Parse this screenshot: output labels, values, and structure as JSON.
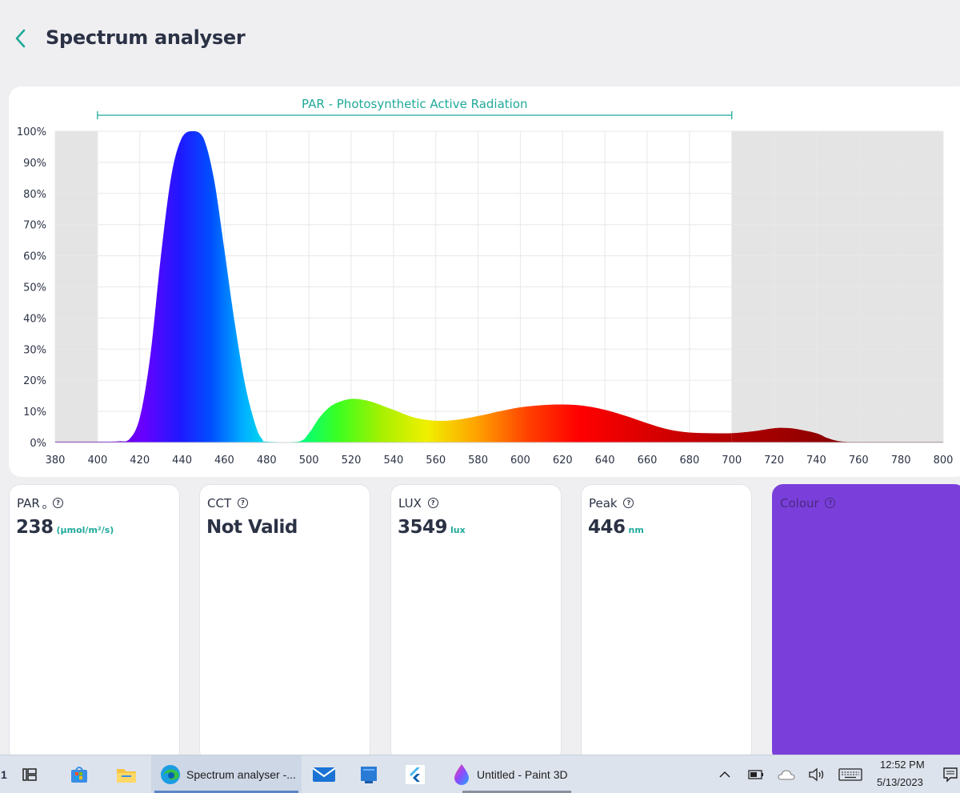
{
  "header": {
    "title": "Spectrum analyser"
  },
  "chart_data": {
    "type": "area",
    "title": "PAR - Photosynthetic Active Radiation",
    "xlabel": "",
    "ylabel": "",
    "xlim": [
      380,
      800
    ],
    "ylim": [
      0,
      100
    ],
    "x_ticks": [
      "380",
      "400",
      "420",
      "440",
      "460",
      "480",
      "500",
      "520",
      "540",
      "560",
      "580",
      "600",
      "620",
      "640",
      "660",
      "680",
      "700",
      "720",
      "740",
      "760",
      "780",
      "800"
    ],
    "y_ticks": [
      "0%",
      "10%",
      "20%",
      "30%",
      "40%",
      "50%",
      "60%",
      "70%",
      "80%",
      "90%",
      "100%"
    ],
    "par_range": [
      400,
      700
    ],
    "grid": true,
    "series": [
      {
        "x": [
          380,
          400,
          410,
          415,
          420,
          425,
          430,
          435,
          440,
          445,
          450,
          455,
          460,
          465,
          470,
          475,
          478,
          480,
          495,
          500,
          505,
          510,
          515,
          520,
          525,
          530,
          540,
          550,
          560,
          570,
          580,
          590,
          600,
          610,
          620,
          630,
          640,
          650,
          660,
          670,
          680,
          690,
          700,
          710,
          720,
          725,
          730,
          740,
          745,
          750,
          755,
          760,
          780,
          800
        ],
        "y": [
          0.3,
          0.3,
          0.4,
          1,
          8,
          28,
          60,
          86,
          98,
          100,
          98,
          85,
          62,
          38,
          18,
          5,
          1,
          0.3,
          0.3,
          3,
          8,
          11.5,
          13.2,
          14,
          13.8,
          13,
          10.5,
          8,
          7,
          7.3,
          8.5,
          10,
          11.3,
          12,
          12.2,
          11.8,
          10.5,
          8.5,
          6.2,
          4.2,
          3.2,
          3,
          3,
          3.6,
          4.6,
          4.7,
          4.4,
          3,
          1.5,
          0.5,
          0.2,
          0.2,
          0.2,
          0.2
        ]
      }
    ]
  },
  "cards": {
    "par": {
      "label": "PAR",
      "sub": "o",
      "value": "238",
      "unit": "(μmol/m²/s)"
    },
    "cct": {
      "label": "CCT",
      "value": "Not Valid"
    },
    "lux": {
      "label": "LUX",
      "value": "3549",
      "unit": "lux"
    },
    "peak": {
      "label": "Peak",
      "value": "446",
      "unit": "nm"
    },
    "colour": {
      "label": "Colour",
      "color": "#7a3fdb"
    }
  },
  "help_icon_glyph": "?",
  "taskbar": {
    "edge_label": "Spectrum analyser -...",
    "paint_label": "Untitled - Paint 3D",
    "time": "12:52 PM",
    "date": "5/13/2023"
  },
  "colors": {
    "accent": "#1fa99a",
    "text": "#2b3245"
  }
}
